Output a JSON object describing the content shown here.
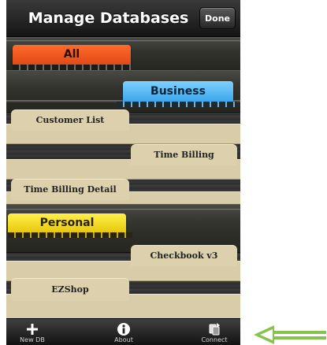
{
  "navbar": {
    "title": "Manage Databases",
    "done_label": "Done"
  },
  "groups": {
    "all": {
      "label": "All",
      "color": "#f2541e"
    },
    "business": {
      "label": "Business",
      "color": "#4fb6f5"
    },
    "personal": {
      "label": "Personal",
      "color": "#f5dc23"
    }
  },
  "databases": {
    "customer_list": "Customer List",
    "time_billing": "Time Billing",
    "time_billing_detail": "Time Billing Detail",
    "checkbook": "Checkbook v3",
    "ezshop": "EZShop"
  },
  "toolbar": {
    "new_db_label": "New DB",
    "new_db_icon": "plus-icon",
    "about_label": "About",
    "about_icon": "info-icon",
    "connect_label": "Connect",
    "connect_icon": "sync-connect-icon"
  },
  "annotation": {
    "arrow_color": "#86c34d",
    "arrow_icon": "left-arrow-icon"
  }
}
